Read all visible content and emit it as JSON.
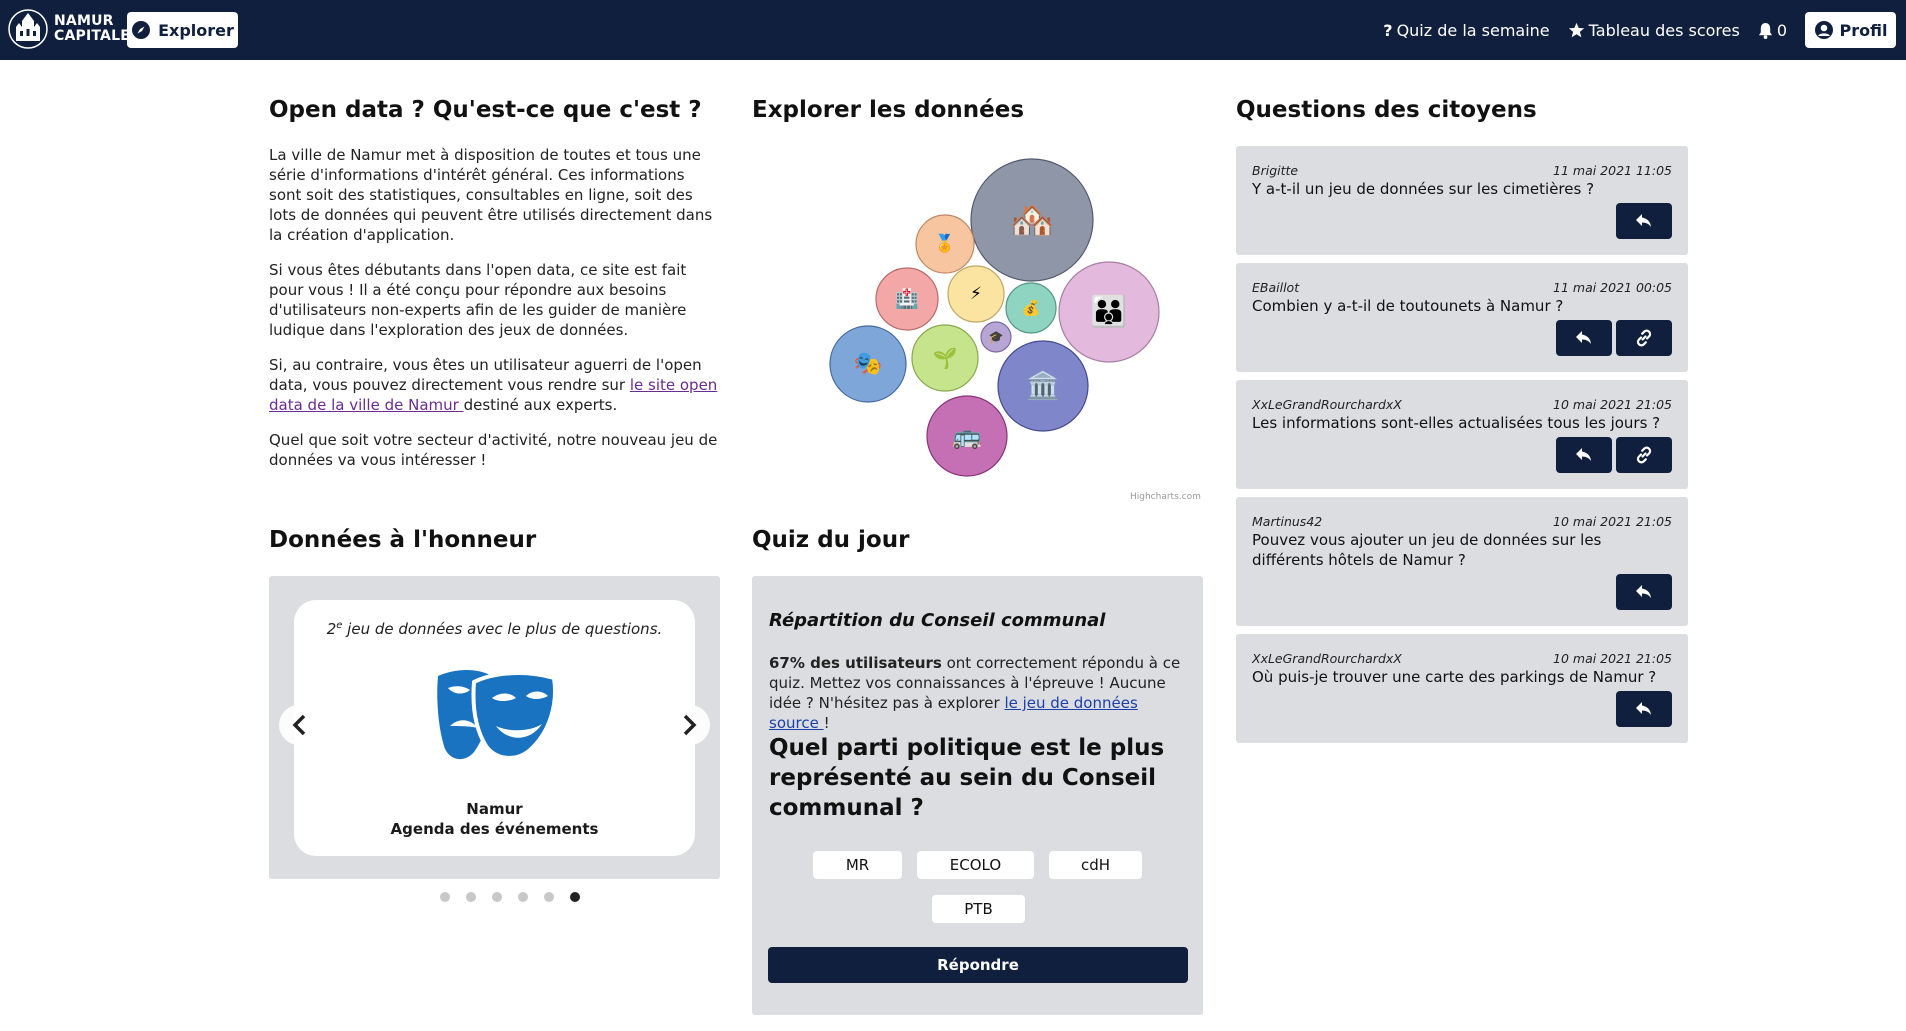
{
  "navbar": {
    "logo_line1": "NAMUR",
    "logo_line2": "CAPITALE",
    "explorer_label": "Explorer",
    "quiz_semaine_label": "Quiz de la semaine",
    "scores_label": "Tableau des scores",
    "notif_count": "0",
    "profil_label": "Profil",
    "colors": {
      "bg": "#0f1f3d",
      "button_bg": "#ffffff"
    }
  },
  "opendata": {
    "title": "Open data ? Qu'est-ce que c'est ?",
    "p1": "La ville de Namur met à disposition de toutes et tous une série d'informations d'intérêt général. Ces informations sont soit des statistiques, consultables en ligne, soit des lots de données qui peuvent être utilisés directement dans la création d'application.",
    "p2": "Si vous êtes débutants dans l'open data, ce site est fait pour vous ! Il a été conçu pour répondre aux besoins d'utilisateurs non-experts afin de les guider de manière ludique dans l'exploration des jeux de données.",
    "p3_before": "Si, au contraire, vous êtes un utilisateur aguerri de l'open data, vous pouvez directement vous rendre sur ",
    "p3_link": "le site open data de la ville de Namur ",
    "p3_after": "destiné aux experts.",
    "p4": "Quel que soit votre secteur d'activité, notre nouveau jeu de données va vous intéresser !"
  },
  "explorer": {
    "title": "Explorer les données",
    "credits": "Highcharts.com",
    "bubbles": [
      {
        "name": "housing",
        "icon": "houses-icon",
        "glyph": "🏘️",
        "color": "#8f96a8"
      },
      {
        "name": "medal",
        "icon": "medal-icon",
        "glyph": "🏅",
        "color": "#f7c59f"
      },
      {
        "name": "health",
        "icon": "hospital-icon",
        "glyph": "🏥",
        "color": "#f4a7a7"
      },
      {
        "name": "energy",
        "icon": "lightning-icon",
        "glyph": "⚡",
        "color": "#fbe3a1"
      },
      {
        "name": "finance",
        "icon": "money-bag-icon",
        "glyph": "💰",
        "color": "#8fd3c1"
      },
      {
        "name": "family",
        "icon": "family-icon",
        "glyph": "👪",
        "color": "#e3b9dd"
      },
      {
        "name": "culture",
        "icon": "theater-masks-icon",
        "glyph": "🎭",
        "color": "#7ea6d9"
      },
      {
        "name": "environment",
        "icon": "seedling-icon",
        "glyph": "🌱",
        "color": "#c6e48b"
      },
      {
        "name": "education",
        "icon": "graduation-icon",
        "glyph": "🎓",
        "color": "#b7a5d6"
      },
      {
        "name": "administration",
        "icon": "classical-building-icon",
        "glyph": "🏛️",
        "color": "#7f86c9"
      },
      {
        "name": "mobility",
        "icon": "bus-icon",
        "glyph": "🚌",
        "color": "#c56fb5"
      }
    ]
  },
  "honneur": {
    "title": "Données à l'honneur",
    "caption_num": "2",
    "caption_sup": "e",
    "caption_rest": " jeu de données avec le plus de questions.",
    "dataset_owner": "Namur",
    "dataset_name": "Agenda des événements",
    "icon": "theater-masks-icon",
    "accent": "#1a73c0",
    "slides": 6,
    "active_slide": 6
  },
  "quiz": {
    "title": "Quiz du jour",
    "subtitle": "Répartition du Conseil communal",
    "stat_bold": "67% des utilisateurs",
    "stat_rest": " ont correctement répondu à ce quiz. Mettez vos connaissances à l'épreuve ! Aucune idée ? N'hésitez pas à explorer ",
    "stat_link": "le jeu de données source ",
    "stat_end": "!",
    "question": "Quel parti politique est le plus représenté au sein du Conseil communal ?",
    "options": [
      "MR",
      "ECOLO",
      "cdH",
      "PTB"
    ],
    "submit_label": "Répondre"
  },
  "questions": {
    "title": "Questions des citoyens",
    "items": [
      {
        "author": "Brigitte",
        "date": "11 mai 2021 11:05",
        "text": "Y a-t-il un jeu de données sur les cimetières ?",
        "has_link": false
      },
      {
        "author": "EBaillot",
        "date": "11 mai 2021 00:05",
        "text": "Combien y a-t-il de toutounets à Namur ?",
        "has_link": true
      },
      {
        "author": "XxLeGrandRourchardxX",
        "date": "10 mai 2021 21:05",
        "text": "Les informations sont-elles actualisées tous les jours ?",
        "has_link": true
      },
      {
        "author": "Martinus42",
        "date": "10 mai 2021 21:05",
        "text": "Pouvez vous ajouter un jeu de données sur les différents hôtels de Namur ?",
        "has_link": false
      },
      {
        "author": "XxLeGrandRourchardxX",
        "date": "10 mai 2021 21:05",
        "text": "Où puis-je trouver une carte des parkings de Namur ?",
        "has_link": false
      }
    ]
  }
}
